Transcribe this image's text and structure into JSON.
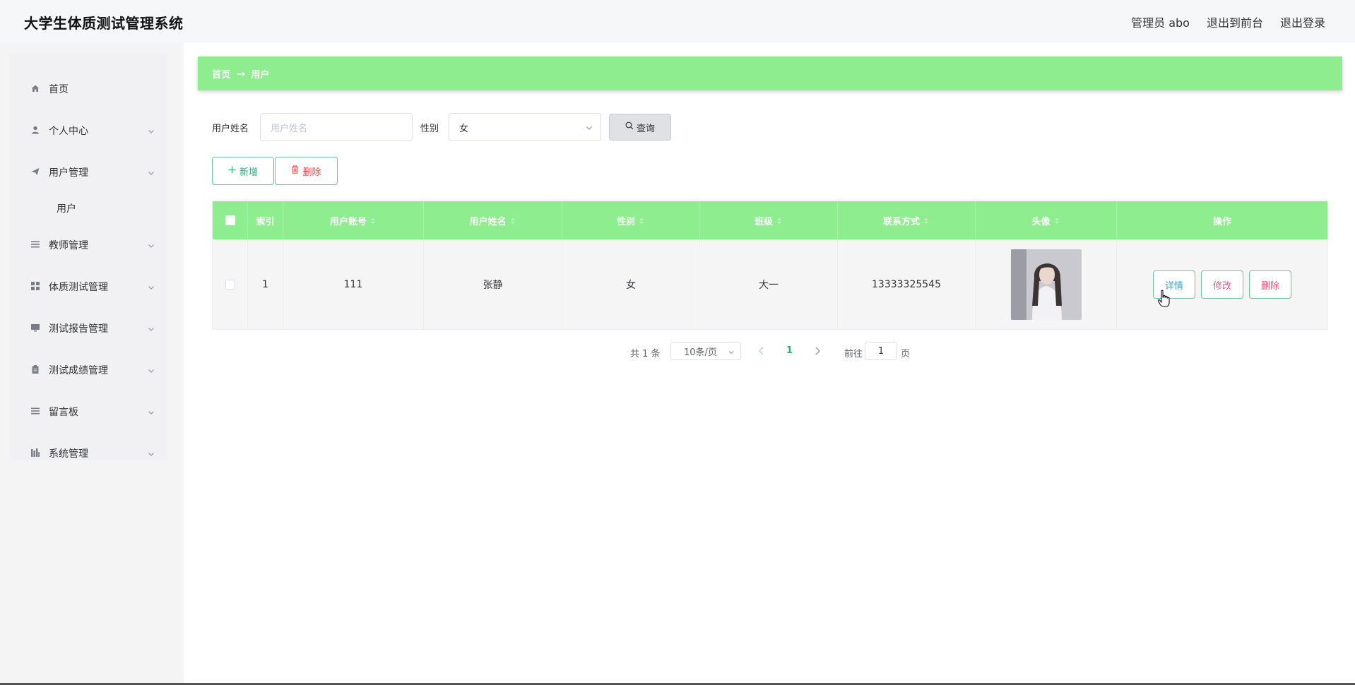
{
  "header": {
    "title": "大学生体质测试管理系统",
    "admin_label": "管理员 abo",
    "to_frontend": "退出到前台",
    "logout": "退出登录"
  },
  "sidebar": {
    "items": [
      {
        "label": "首页",
        "icon": "home-icon"
      },
      {
        "label": "个人中心",
        "icon": "user-icon"
      },
      {
        "label": "用户管理",
        "icon": "paper-plane-icon"
      },
      {
        "label": "用户",
        "icon": ""
      },
      {
        "label": "教师管理",
        "icon": "list-icon"
      },
      {
        "label": "体质测试管理",
        "icon": "grid-icon"
      },
      {
        "label": "测试报告管理",
        "icon": "monitor-icon"
      },
      {
        "label": "测试成绩管理",
        "icon": "clipboard-icon"
      },
      {
        "label": "留言板",
        "icon": "list-icon"
      },
      {
        "label": "系统管理",
        "icon": "chart-icon"
      }
    ]
  },
  "breadcrumb": {
    "home": "首页",
    "separator": "→",
    "current": "用户"
  },
  "search": {
    "name_label": "用户姓名",
    "name_placeholder": "用户姓名",
    "gender_label": "性别",
    "gender_value": "女",
    "query_label": "查询"
  },
  "actions": {
    "add_label": "新增",
    "delete_label": "删除"
  },
  "table": {
    "columns": [
      "索引",
      "用户账号",
      "用户姓名",
      "性别",
      "班级",
      "联系方式",
      "头像",
      "操作"
    ],
    "rows": [
      {
        "index": "1",
        "account": "111",
        "name": "张静",
        "gender": "女",
        "class": "大一",
        "phone": "13333325545",
        "ops": {
          "detail": "详情",
          "edit": "修改",
          "delete": "删除"
        }
      }
    ]
  },
  "pagination": {
    "total": "共 1 条",
    "page_size": "10条/页",
    "current_page": "1",
    "goto_label": "前往",
    "goto_value": "1",
    "page_unit": "页"
  },
  "colors": {
    "accent_green": "#8eed8e",
    "active_page": "#2bb36a"
  }
}
